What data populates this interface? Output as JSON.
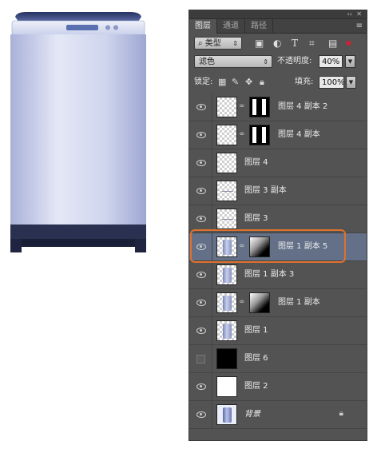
{
  "panel": {
    "tabs": [
      "图层",
      "通道",
      "路径"
    ],
    "active_tab": 0,
    "collapse_glyph": "‹‹",
    "close_glyph": "✕",
    "menu_glyph": "≡",
    "filter": {
      "label": "类型",
      "glyph": "⌕"
    },
    "filter_icons": [
      "image-filter-icon",
      "adjustment-filter-icon",
      "type-filter-icon",
      "shape-filter-icon",
      "smart-object-filter-icon"
    ],
    "blend_mode": "滤色",
    "opacity_label": "不透明度:",
    "opacity_value": "40%",
    "lock_label": "锁定:",
    "fill_label": "填充:",
    "fill_value": "100%"
  },
  "layers": [
    {
      "name": "图层 4 副本 2",
      "visible": true,
      "thumb": "transparent",
      "mask": "bars",
      "linked": true,
      "selected": false
    },
    {
      "name": "图层 4 副本",
      "visible": true,
      "thumb": "transparent",
      "mask": "bars",
      "linked": true,
      "selected": false
    },
    {
      "name": "图层 4",
      "visible": true,
      "thumb": "transparent",
      "mask": null,
      "linked": false,
      "selected": false
    },
    {
      "name": "图层 3 副本",
      "visible": true,
      "thumb": "transparent-line",
      "mask": null,
      "linked": false,
      "selected": false
    },
    {
      "name": "图层 3",
      "visible": true,
      "thumb": "transparent-line",
      "mask": null,
      "linked": false,
      "selected": false
    },
    {
      "name": "图层 1 副本 5",
      "visible": true,
      "thumb": "machine",
      "mask": "gradient",
      "linked": true,
      "selected": true
    },
    {
      "name": "图层 1 副本 3",
      "visible": true,
      "thumb": "machine",
      "mask": null,
      "linked": false,
      "selected": false
    },
    {
      "name": "图层 1 副本",
      "visible": true,
      "thumb": "machine",
      "mask": "gradient",
      "linked": true,
      "selected": false
    },
    {
      "name": "图层 1",
      "visible": true,
      "thumb": "machine",
      "mask": null,
      "linked": false,
      "selected": false
    },
    {
      "name": "图层 6",
      "visible": false,
      "thumb": "black",
      "mask": null,
      "linked": false,
      "selected": false
    },
    {
      "name": "图层 2",
      "visible": true,
      "thumb": "white",
      "mask": null,
      "linked": false,
      "selected": false
    },
    {
      "name": "背景",
      "visible": true,
      "thumb": "background",
      "mask": null,
      "linked": false,
      "selected": false,
      "locked": true,
      "italic": true
    }
  ],
  "colors": {
    "panel_bg": "#535353",
    "selected_row": "#637088",
    "highlight_outline": "#e0712c",
    "machine_body": "#c3c9e6",
    "machine_base": "#232846"
  }
}
